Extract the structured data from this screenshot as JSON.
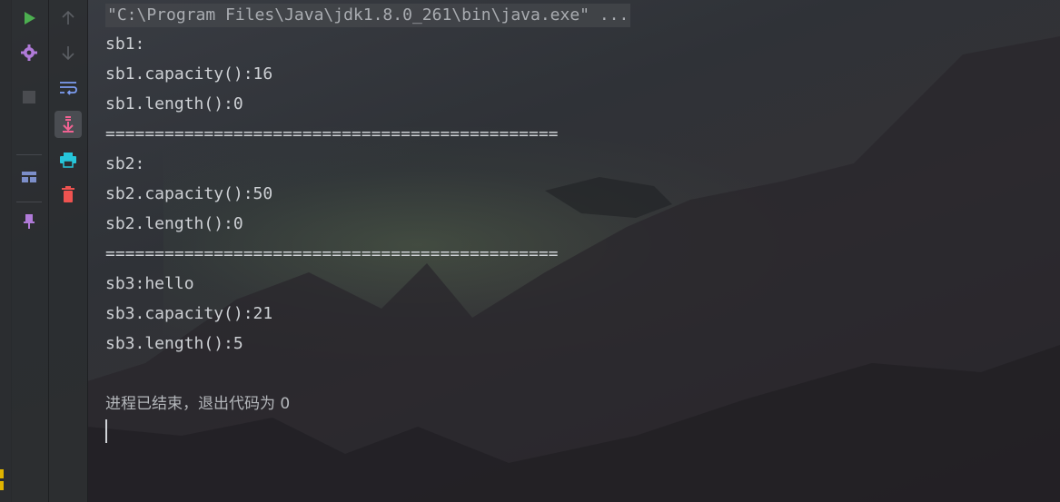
{
  "toolbar_left": {
    "run": "run-icon",
    "settings": "gear-icon",
    "stop": "stop-icon",
    "layout": "layout-icon",
    "pin": "pin-icon"
  },
  "toolbar_right": {
    "up": "arrow-up-icon",
    "down": "arrow-down-icon",
    "soft_wrap": "soft-wrap-icon",
    "scroll_to_end": "scroll-to-end-icon",
    "print": "print-icon",
    "clear": "trash-icon"
  },
  "console": {
    "command": "\"C:\\Program Files\\Java\\jdk1.8.0_261\\bin\\java.exe\" ...",
    "lines": [
      "sb1:",
      "sb1.capacity():16",
      "sb1.length():0",
      "==============================================",
      "sb2:",
      "sb2.capacity():50",
      "sb2.length():0",
      "==============================================",
      "sb3:hello",
      "sb3.capacity():21",
      "sb3.length():5",
      "",
      "进程已结束，退出代码为 0"
    ]
  },
  "colors": {
    "run_green": "#4caf50",
    "gear_purple": "#b07ad8",
    "scroll_pink": "#f06292",
    "print_cyan": "#26c6da",
    "trash_red": "#ef5350",
    "soft_wrap_blue": "#7c9cf0"
  }
}
